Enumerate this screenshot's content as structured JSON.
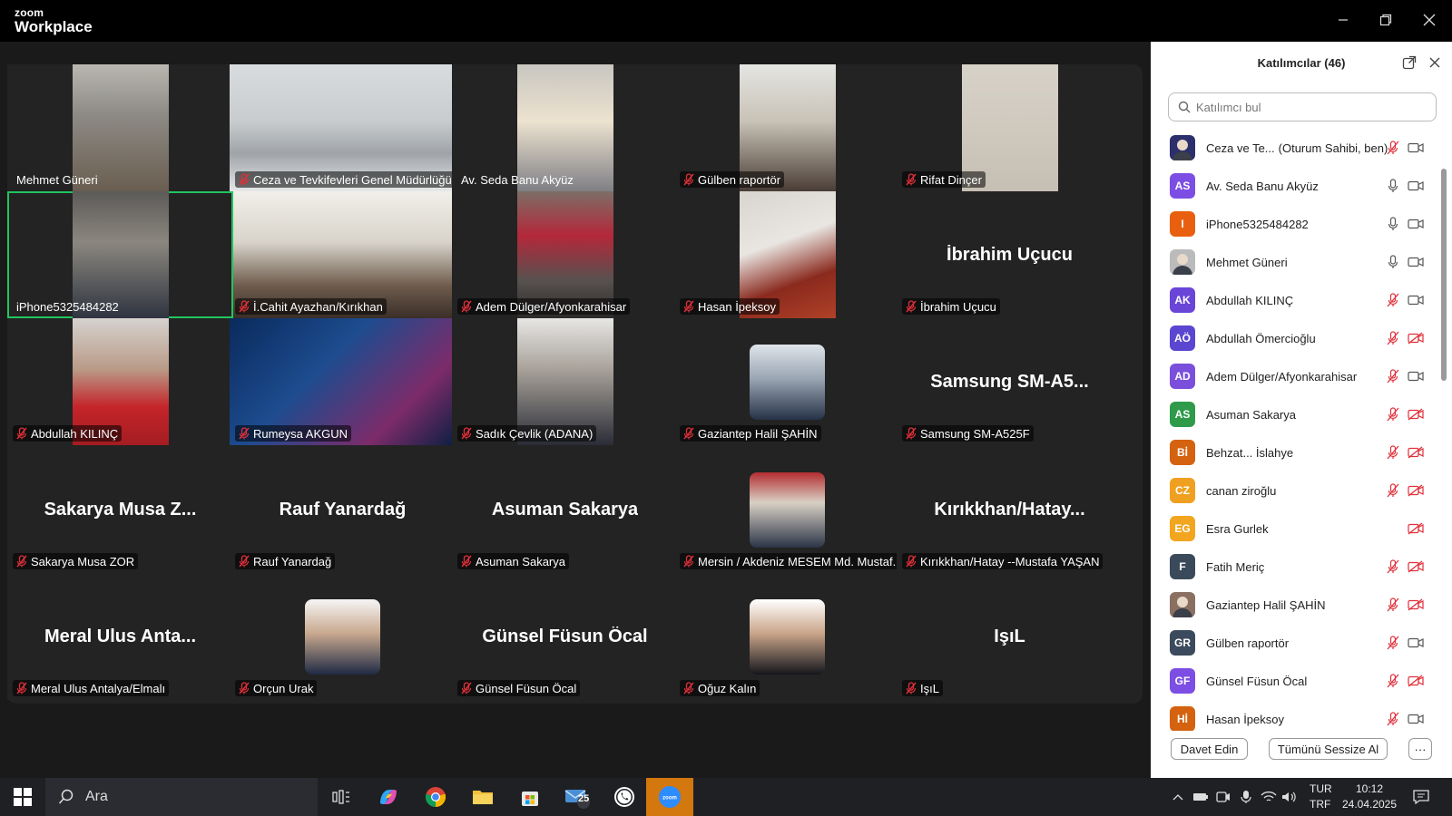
{
  "app": {
    "brand_top": "zoom",
    "brand_bottom": "Workplace"
  },
  "gallery": {
    "tiles": [
      {
        "name": "Mehmet Güneri",
        "muted": false,
        "display": "video",
        "video_style": "narrow",
        "bg": "linear-gradient(180deg,#b9b7b0 0%,#8d8a85 40%,#6a5e50 100%)"
      },
      {
        "name": "Ceza ve Tevkifevleri Genel Müdürlüğü",
        "muted": true,
        "display": "video",
        "video_style": "wide",
        "bg": "linear-gradient(180deg,#d9dcdf 0%,#c9ccce 45%,#9fa3a8 70%,#e6e7e8 100%)"
      },
      {
        "name": "Av. Seda Banu Akyüz",
        "muted": false,
        "display": "video",
        "video_style": "narrow",
        "bg": "linear-gradient(180deg,#c8c6c0 0%,#ece2cf 45%,#7f7f85 100%)"
      },
      {
        "name": "Gülben raportör",
        "muted": true,
        "display": "video",
        "video_style": "narrow",
        "bg": "linear-gradient(180deg,#e5e5e3 0%,#c8c2b6 45%,#4a3d36 100%)"
      },
      {
        "name": "Rifat Dinçer",
        "muted": true,
        "display": "video",
        "video_style": "narrow",
        "bg": "linear-gradient(180deg,#d7d2c8 0%,#cfc9be 50%,#c6bfb3 100%)"
      },
      {
        "name": "iPhone5325484282",
        "muted": false,
        "display": "video",
        "video_style": "narrow",
        "bg": "linear-gradient(180deg,#5c5a58 0%,#8b877f 40%,#2f3440 100%)",
        "active": true
      },
      {
        "name": "İ.Cahit Ayazhan/Kırıkhan",
        "muted": true,
        "display": "video",
        "video_style": "wide",
        "bg": "linear-gradient(180deg,#f1efe9 0%,#d8d4cb 40%,#6d5a4b 75%,#3a2f29 100%)"
      },
      {
        "name": "Adem Dülger/Afyonkarahisar",
        "muted": true,
        "display": "video",
        "video_style": "narrow",
        "bg": "linear-gradient(180deg,#7d6e66 0%,#b3283a 35%,#58514f 70%,#2e2c2b 100%)"
      },
      {
        "name": "Hasan İpeksoy",
        "muted": true,
        "display": "video",
        "video_style": "narrow",
        "bg": "linear-gradient(160deg,#d8d4d0 0%,#e9e6e2 40%,#8a2a1e 70%,#b04127 100%)"
      },
      {
        "name": "İbrahim Uçucu",
        "muted": true,
        "display": "name",
        "big": "İbrahim Uçucu"
      },
      {
        "name": "Abdullah KILINÇ",
        "muted": true,
        "display": "video",
        "video_style": "narrow",
        "bg": "linear-gradient(180deg,#d6d3cf 0%,#b99b88 40%,#c4242a 70%,#a41d22 100%)"
      },
      {
        "name": "Rumeysa AKGUN",
        "muted": true,
        "display": "video",
        "video_style": "wide",
        "bg": "linear-gradient(135deg,#0a2a5c 0%,#1d4c8f 40%,#7c2b6a 75%,#0b1f42 100%)"
      },
      {
        "name": "Sadık Çevlik (ADANA)",
        "muted": true,
        "display": "video",
        "video_style": "narrow",
        "bg": "linear-gradient(180deg,#e7e6e4 0%,#a8a29a 40%,#2a2c36 100%)"
      },
      {
        "name": "Gaziantep Halil ŞAHİN",
        "muted": true,
        "display": "avatar",
        "bg": "linear-gradient(180deg,#dfe4ea 0%,#9aa6b3 45%,#263247 100%)"
      },
      {
        "name": "Samsung SM-A525F",
        "muted": true,
        "display": "name",
        "big": "Samsung SM-A5..."
      },
      {
        "name": "Sakarya Musa ZOR",
        "muted": true,
        "display": "name",
        "big": "Sakarya Musa Z..."
      },
      {
        "name": "Rauf Yanardağ",
        "muted": true,
        "display": "name",
        "big": "Rauf Yanardağ"
      },
      {
        "name": "Asuman Sakarya",
        "muted": true,
        "display": "name",
        "big": "Asuman Sakarya"
      },
      {
        "name": "Mersin / Akdeniz MESEM Md. Mustaf...",
        "muted": true,
        "display": "avatar",
        "bg": "linear-gradient(180deg,#b32d31 0%,#d8d0c4 40%,#2b3447 100%)"
      },
      {
        "name": "Kırıkkhan/Hatay --Mustafa YAŞAN",
        "muted": true,
        "display": "name",
        "big": "Kırıkkhan/Hatay..."
      },
      {
        "name": "Meral Ulus Antalya/Elmalı",
        "muted": true,
        "display": "name",
        "big": "Meral Ulus Anta..."
      },
      {
        "name": "Orçun Urak",
        "muted": true,
        "display": "avatar",
        "bg": "linear-gradient(180deg,#f5f5f5 0%,#c9a98f 45%,#1f2a44 100%)"
      },
      {
        "name": "Günsel Füsun Öcal",
        "muted": true,
        "display": "name",
        "big": "Günsel Füsun Öcal"
      },
      {
        "name": "Oğuz Kalın",
        "muted": true,
        "display": "avatar",
        "bg": "linear-gradient(180deg,#ffffff 0%,#caa58a 45%,#15161c 100%)"
      },
      {
        "name": "IşıL",
        "muted": true,
        "display": "name",
        "big": "IşıL"
      }
    ]
  },
  "panel": {
    "title": "Katılımcılar (46)",
    "search_placeholder": "Katılımcı bul",
    "participants": [
      {
        "initials": "",
        "color": "#2b2f6b",
        "name": "Ceza ve Te...",
        "tag": "(Oturum Sahibi, ben)",
        "mic": "muted",
        "cam": "on",
        "photo": true
      },
      {
        "initials": "AS",
        "color": "#7c4ee4",
        "name": "Av. Seda Banu Akyüz",
        "mic": "on",
        "cam": "on"
      },
      {
        "initials": "I",
        "color": "#e8600f",
        "name": "iPhone5325484282",
        "mic": "on",
        "cam": "on"
      },
      {
        "initials": "",
        "color": "#bbbbbb",
        "name": "Mehmet Güneri",
        "mic": "on",
        "cam": "on",
        "photo": true
      },
      {
        "initials": "AK",
        "color": "#6a46d8",
        "name": "Abdullah KILINÇ",
        "mic": "muted",
        "cam": "on"
      },
      {
        "initials": "AÖ",
        "color": "#5a46d0",
        "name": "Abdullah Ömercioğlu",
        "mic": "muted",
        "cam": "off"
      },
      {
        "initials": "AD",
        "color": "#7a4fdc",
        "name": "Adem Dülger/Afyonkarahisar",
        "mic": "muted",
        "cam": "on"
      },
      {
        "initials": "AS",
        "color": "#2e9a4a",
        "name": "Asuman Sakarya",
        "mic": "muted",
        "cam": "off"
      },
      {
        "initials": "Bİ",
        "color": "#d4620f",
        "name": "Behzat... İslahye",
        "mic": "muted",
        "cam": "off"
      },
      {
        "initials": "CZ",
        "color": "#f0a020",
        "name": "canan ziroğlu",
        "mic": "muted",
        "cam": "off"
      },
      {
        "initials": "EG",
        "color": "#f2a51e",
        "name": "Esra Gurlek",
        "mic": "",
        "cam": "off"
      },
      {
        "initials": "F",
        "color": "#3a4a5a",
        "name": "Fatih Meriç",
        "mic": "muted",
        "cam": "off"
      },
      {
        "initials": "",
        "color": "#8a7060",
        "name": "Gaziantep Halil ŞAHİN",
        "mic": "muted",
        "cam": "off",
        "photo": true
      },
      {
        "initials": "GR",
        "color": "#3b4a5c",
        "name": "Gülben raportör",
        "mic": "muted",
        "cam": "on"
      },
      {
        "initials": "GF",
        "color": "#7c4ee4",
        "name": "Günsel Füsun Öcal",
        "mic": "muted",
        "cam": "off"
      },
      {
        "initials": "Hİ",
        "color": "#d4620f",
        "name": "Hasan İpeksoy",
        "mic": "muted",
        "cam": "on"
      }
    ],
    "invite_label": "Davet Edin",
    "mute_all_label": "Tümünü Sessize Al",
    "more_label": "···"
  },
  "taskbar": {
    "search_text": "Ara",
    "mail_badge": "25",
    "lang_line1": "TUR",
    "lang_line2": "TRF",
    "time": "10:12",
    "date": "24.04.2025"
  },
  "colors": {
    "active_speaker": "#22c45e",
    "muted_red": "#e0303a",
    "zoom_taskbar": "#d3770f"
  }
}
